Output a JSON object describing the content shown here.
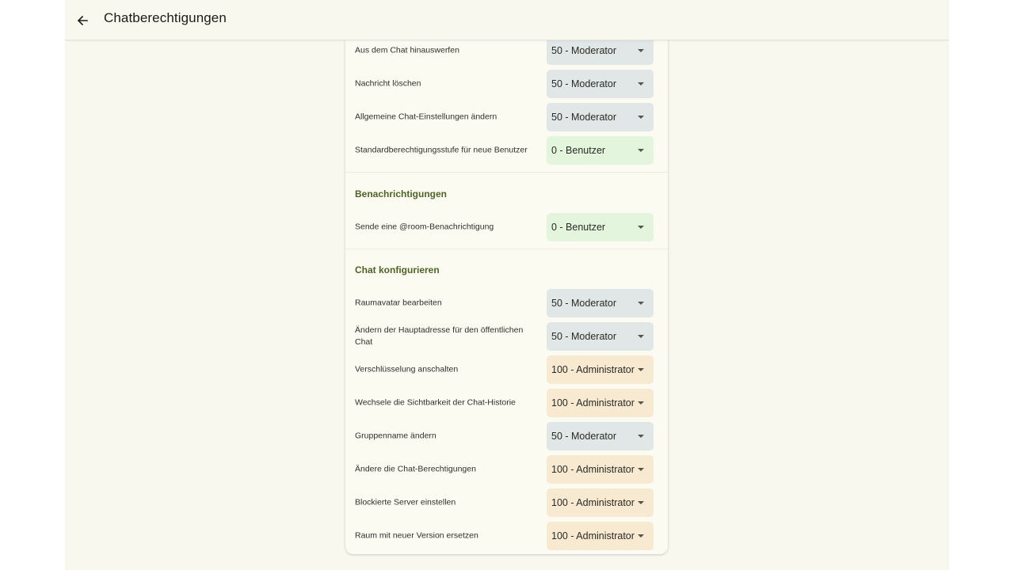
{
  "header": {
    "back_icon": "arrow-left-icon",
    "title": "Chatberechtigungen"
  },
  "levels": {
    "moderator": "50 - Moderator",
    "user": "0 - Benutzer",
    "admin": "100 - Administrator"
  },
  "colors": {
    "moderator_bg": "#e1e7e6",
    "user_bg": "#e3f6dd",
    "admin_bg": "#f8ead1",
    "section_title": "#4c6423",
    "background": "#f8f8ee"
  },
  "rows_top": [
    {
      "label": "Aus dem Chat hinauswerfen",
      "value": "50 - Moderator"
    },
    {
      "label": "Nachricht löschen",
      "value": "50 - Moderator"
    },
    {
      "label": "Allgemeine Chat-Einstellungen ändern",
      "value": "50 - Moderator"
    },
    {
      "label": "Standardberechtigungsstufe für neue Benutzer",
      "value": "0 - Benutzer"
    }
  ],
  "notifications": {
    "title": "Benachrichtigungen",
    "rows": [
      {
        "label": "Sende eine @room-Benachrichtigung",
        "value": "0 - Benutzer"
      }
    ]
  },
  "configure": {
    "title": "Chat konfigurieren",
    "rows": [
      {
        "label": "Raumavatar bearbeiten",
        "value": "50 - Moderator"
      },
      {
        "label": "Ändern der Hauptadresse für den öffentlichen Chat",
        "value": "50 - Moderator"
      },
      {
        "label": "Verschlüsselung anschalten",
        "value": "100 - Administrator"
      },
      {
        "label": "Wechsele die Sichtbarkeit der Chat-Historie",
        "value": "100 - Administrator"
      },
      {
        "label": "Gruppenname ändern",
        "value": "50 - Moderator"
      },
      {
        "label": "Ändere die Chat-Berechtigungen",
        "value": "100 - Administrator"
      },
      {
        "label": "Blockierte Server einstellen",
        "value": "100 - Administrator"
      },
      {
        "label": "Raum mit neuer Version ersetzen",
        "value": "100 - Administrator"
      }
    ]
  }
}
